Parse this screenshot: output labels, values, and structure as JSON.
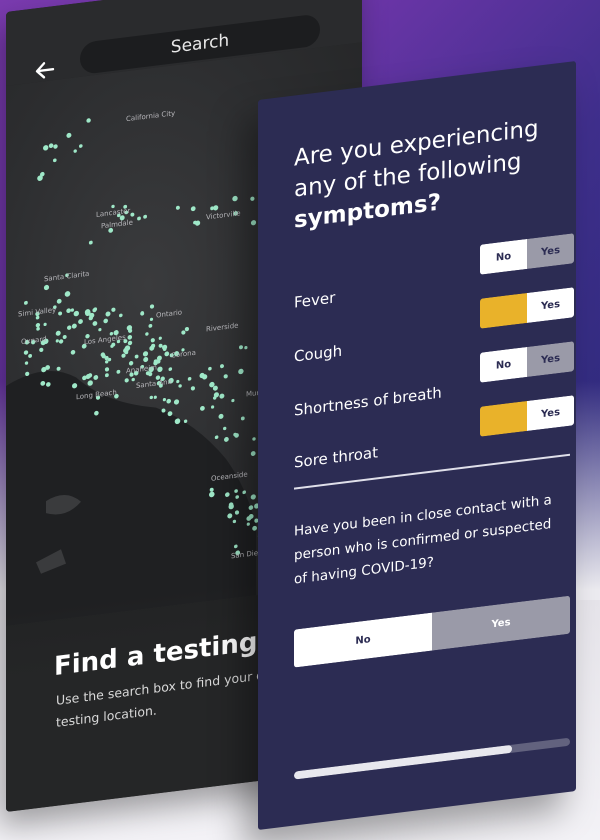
{
  "map_screen": {
    "search_label": "Search",
    "map_labels": [
      "California City",
      "Lancaster",
      "Palmdale",
      "Victorville",
      "Santa Clarita",
      "Simi Valley",
      "Los Angeles",
      "Anaheim",
      "Long Beach",
      "Santa Ana",
      "Riverside",
      "Corona",
      "Murrieta",
      "Oceanside",
      "San Diego",
      "Ontario",
      "Oxnard"
    ],
    "heading": "Find a testing loc",
    "subtext": "Use the search box to find your clo testing location."
  },
  "survey_screen": {
    "title_line1": "Are you experiencing",
    "title_line2": "any of the following",
    "title_bold": "symptoms?",
    "toggle_no": "No",
    "toggle_yes": "Yes",
    "symptoms": [
      {
        "label": "Fever",
        "answer": "No"
      },
      {
        "label": "Cough",
        "answer": "Yes"
      },
      {
        "label": "Shortness of breath",
        "answer": "No"
      },
      {
        "label": "Sore throat",
        "answer": "Yes"
      }
    ],
    "contact_question": "Have you been in close contact with a person who is confirmed or suspected of having COVID-19?",
    "contact_answer": "No",
    "progress": 0.79
  },
  "colors": {
    "panel": "#2c2c53",
    "amber": "#e9b22a",
    "map_dot": "#9fe8c8"
  }
}
